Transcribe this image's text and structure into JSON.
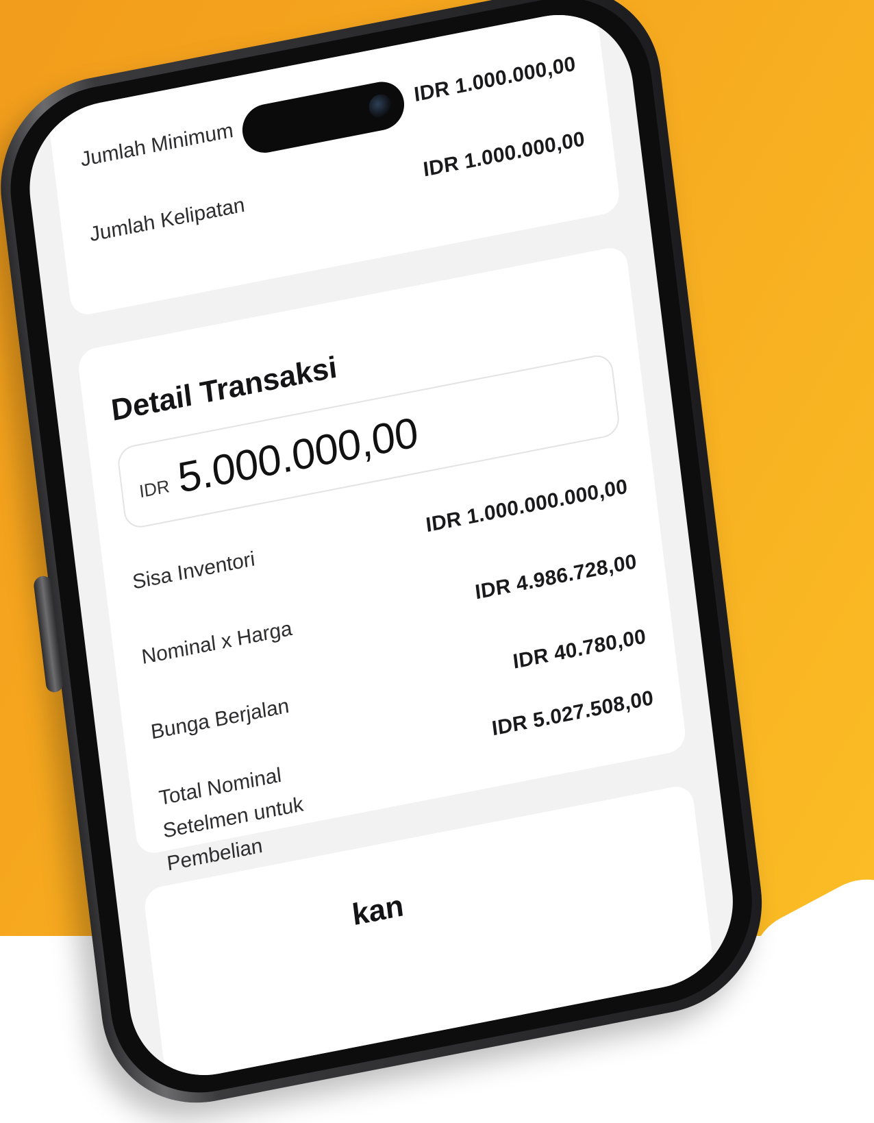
{
  "top_card": {
    "rows": [
      {
        "label": "Jumlah Minimum",
        "value": "IDR 1.000.000,00"
      },
      {
        "label": "Jumlah Kelipatan",
        "value": "IDR 1.000.000,00"
      }
    ]
  },
  "detail": {
    "title": "Detail Transaksi",
    "amount_input": {
      "currency": "IDR",
      "value": "5.000.000,00"
    },
    "rows": [
      {
        "label": "Sisa Inventori",
        "value": "IDR 1.000.000.000,00"
      },
      {
        "label": "Nominal x Harga",
        "value": "IDR 4.986.728,00"
      },
      {
        "label": "Bunga Berjalan",
        "value": "IDR 40.780,00"
      },
      {
        "label": "Total Nominal Setelmen untuk Pembelian",
        "value": "IDR 5.027.508,00"
      }
    ]
  },
  "bottom_card": {
    "heading_fragment": "kan"
  },
  "colors": {
    "background_start": "#f29d1c",
    "background_end": "#fbbd25",
    "card": "#ffffff",
    "screen": "#f2f2f3",
    "text": "#1a1a1c"
  }
}
